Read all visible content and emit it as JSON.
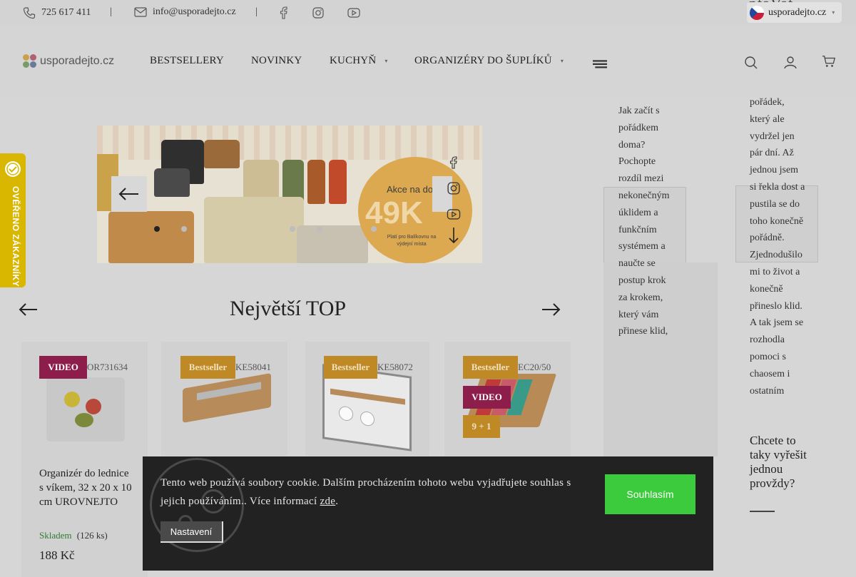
{
  "topbar": {
    "phone": "725 617 411",
    "sep1": "|",
    "email": "info@usporadejto.cz",
    "sep2": "|",
    "language": "usporadejto.cz",
    "overlay_fragment": "ptaVat"
  },
  "header": {
    "logo_text": "usporadejto.cz",
    "nav": [
      {
        "label": "BESTSELLERY"
      },
      {
        "label": "NOVINKY"
      },
      {
        "label": "KUCHYŇ"
      },
      {
        "label": "ORGANIZÉRY DO ŠUPLÍKŮ"
      }
    ]
  },
  "banner": {
    "promo_line1": "Akce na dopr",
    "promo_price": "49K",
    "promo_line3": "Platí pro Balíkovnu na výdejní místa",
    "slides": 5,
    "active_slide": 0
  },
  "sidecol1": {
    "text": "Jak začít s pořádkem doma? Pochopte rozdíl mezi nekonečným úklidem a funkčním systémem a naučte se postup krok za krokem, který vám přinese klid,"
  },
  "sidecol2": {
    "text": "pořádek, který ale vydržel jen pár dní. Až jednou jsem si řekla dost a pustila se do toho konečně pořádně. Zjednodušilo mi to život a konečně přineslo klid. A tak jsem se rozhodla pomoci s chaosem i ostatním",
    "heading": "Chcete to taky vyřešit jednou provždy?"
  },
  "verified_label": "OVĚŘENO ZÁKAZNÍKY",
  "section": {
    "title": "Největší TOP"
  },
  "products": [
    {
      "badges": [
        "VIDEO"
      ],
      "code": "OR731634",
      "name": "Organizér do lednice s víkem, 32 x 20 x 10 cm UROVNEJTO",
      "stock": "Skladem",
      "qty": "(126 ks)",
      "price": "188 Kč"
    },
    {
      "badges": [
        "Bestseller"
      ],
      "code": "KE58041"
    },
    {
      "badges": [
        "Bestseller"
      ],
      "code": "KE58072"
    },
    {
      "badges": [
        "Bestseller",
        "VIDEO",
        "9 + 1"
      ],
      "code": "EC20/50"
    }
  ],
  "cookie": {
    "message": "Tento web používá soubory cookie. Dalším procházením tohoto webu vyjadřujete souhlas s jejich používáním.. Více informací",
    "link": "zde",
    "end": ".",
    "accept": "Souhlasím",
    "settings": "Nastavení"
  },
  "colors": {
    "video_badge": "#8d1d4b",
    "bestseller_badge": "#bf8a26",
    "accept_button": "#3ccb3c",
    "verified_tab": "#d9b600"
  }
}
